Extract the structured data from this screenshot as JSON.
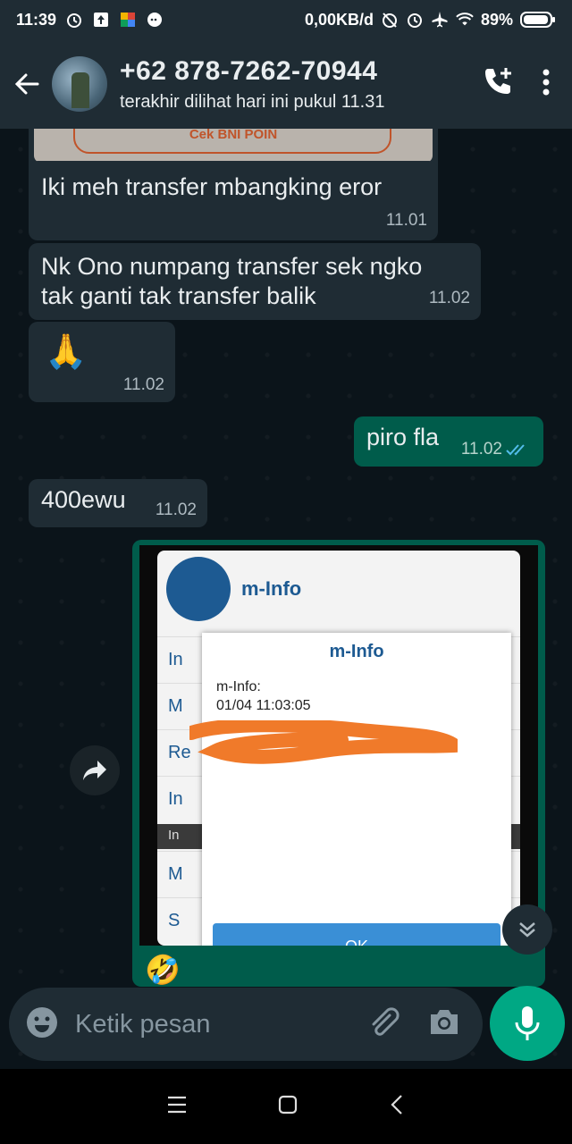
{
  "statusbar": {
    "time": "11:39",
    "net_speed": "0,00KB/d",
    "battery": "89%"
  },
  "header": {
    "contact_name": "+62 878-7262-70944",
    "last_seen": "terakhir dilihat hari ini pukul 11.31"
  },
  "messages": [
    {
      "text": "Cek BNI POIN",
      "partial": true
    },
    {
      "text": "Iki meh transfer mbangking eror",
      "time": "11.01",
      "direction": "in"
    },
    {
      "text": "Nk Ono numpang transfer sek ngko tak ganti tak transfer balik",
      "line1": "Nk Ono numpang transfer sek ngko",
      "line2": "tak ganti tak transfer balik",
      "time": "11.02",
      "direction": "in"
    },
    {
      "text": "🙏",
      "time": "11.02",
      "direction": "in"
    },
    {
      "text": "piro fla",
      "time": "11.02",
      "direction": "out",
      "status": "read"
    },
    {
      "text": "400ewu",
      "time": "11.02",
      "direction": "in"
    }
  ],
  "image_message": {
    "app_title": "m-Info",
    "menu_initials": [
      "In",
      "M",
      "Re",
      "In",
      "In",
      "M",
      "S"
    ],
    "dialog_title": "m-Info",
    "dialog_line1": "m-Info:",
    "dialog_line2": "01/04 11:03:05",
    "ok_label": "OK",
    "caption_emoji": "🤣"
  },
  "composer": {
    "placeholder": "Ketik pesan"
  },
  "colors": {
    "appbar": "#1f2c34",
    "chat_bg": "#0b141a",
    "incoming": "#1f2c34",
    "outgoing": "#005c4b",
    "accent": "#00a884",
    "read_ticks": "#53bdeb"
  }
}
